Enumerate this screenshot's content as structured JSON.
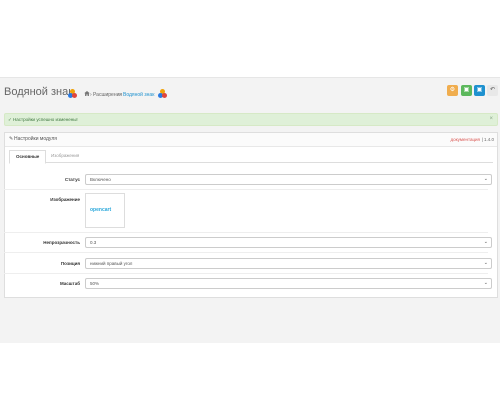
{
  "header": {
    "title": "Водяной знак",
    "breadcrumbs": [
      "Расширения",
      "Водяной знак"
    ],
    "buttons": [
      {
        "icon": "gear-icon",
        "color": "#f0ad4e"
      },
      {
        "icon": "save-icon",
        "color": "#5cb85c"
      },
      {
        "icon": "save-close-icon",
        "color": "#1e91cf"
      },
      {
        "icon": "back-icon",
        "color": "#e8e8e8"
      }
    ]
  },
  "alert": {
    "text": "Настройки успешно изменены!",
    "check_glyph": "✓",
    "close_glyph": "×"
  },
  "panel": {
    "title": "Настройки модуля",
    "doc_link": "документация",
    "version": "| 1.4.0",
    "tabs": [
      "Основные",
      "Изображения"
    ]
  },
  "form": {
    "status": {
      "label": "Статус",
      "value": "Включено"
    },
    "image": {
      "label": "Изображение",
      "preview_text": "opencart"
    },
    "opacity": {
      "label": "Непрозрачность",
      "value": "0.3"
    },
    "position": {
      "label": "Позиция",
      "value": "нижний правый угол"
    },
    "scale": {
      "label": "Масштаб",
      "value": "50%"
    }
  },
  "colors": {
    "accent": "#1e91cf",
    "success_bg": "#dff0d8",
    "doc_link": "#d9534f"
  }
}
